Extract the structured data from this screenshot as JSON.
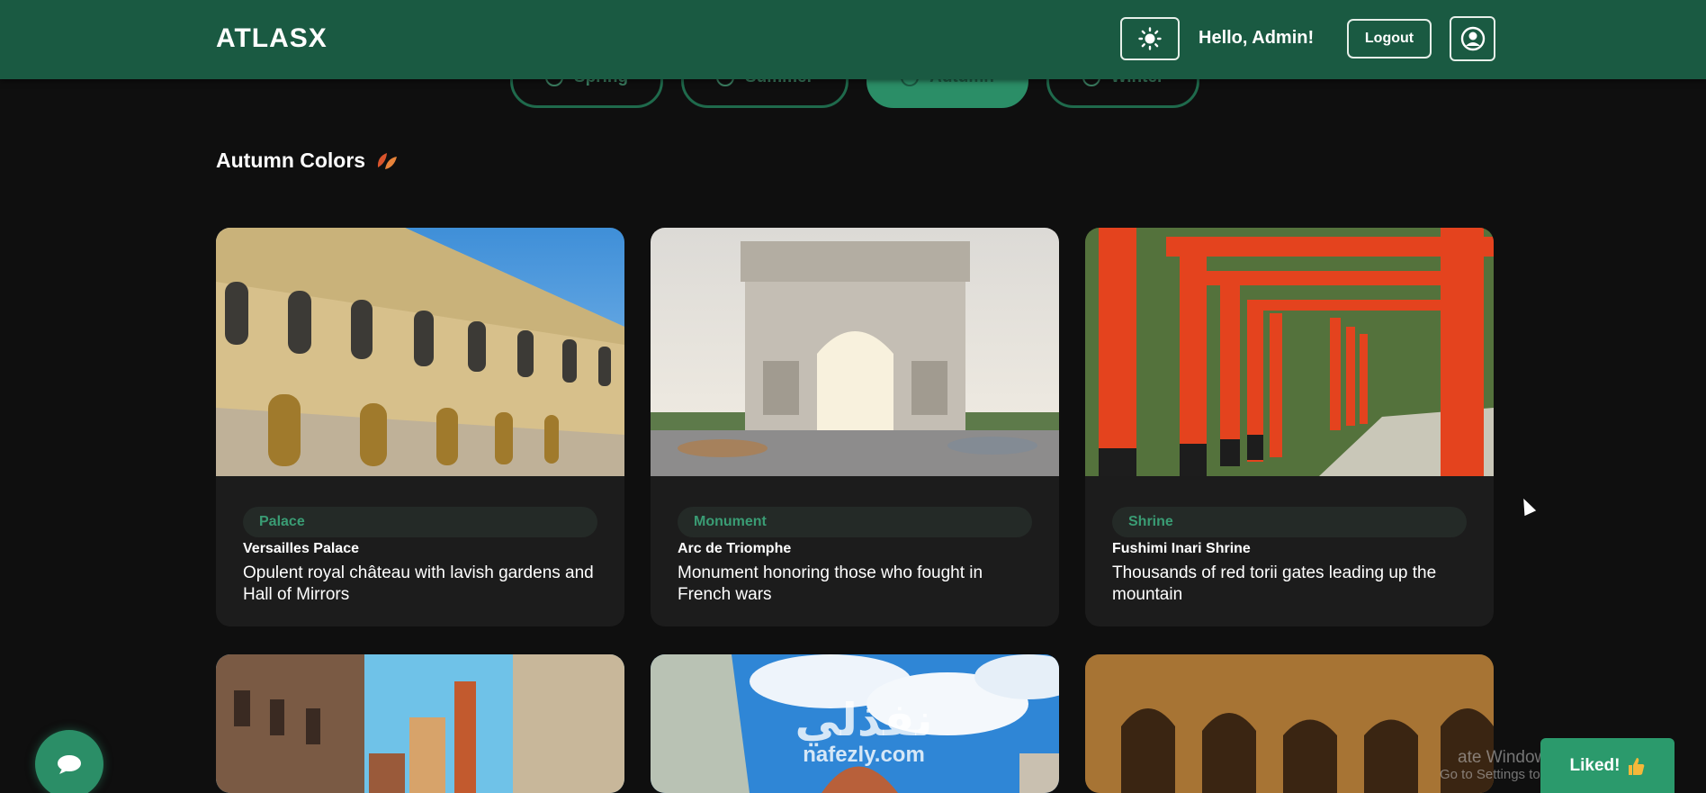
{
  "header": {
    "brand": "ATLASX",
    "greeting": "Hello, Admin!",
    "logout_label": "Logout",
    "theme_icon": "sun-icon",
    "avatar_icon": "user-circle-icon"
  },
  "seasons": [
    {
      "label": "Spring",
      "icon": "flower-icon",
      "active": false
    },
    {
      "label": "Summer",
      "icon": "sun-icon",
      "active": false
    },
    {
      "label": "Autumn",
      "icon": "leaf-icon",
      "active": true
    },
    {
      "label": "Winter",
      "icon": "snowflake-icon",
      "active": false
    }
  ],
  "section": {
    "title": "Autumn Colors",
    "icon": "autumn-leaves-icon"
  },
  "cards": [
    {
      "tag": "Palace",
      "name": "Versailles Palace",
      "description": "Opulent royal château with lavish gardens and Hall of Mirrors"
    },
    {
      "tag": "Monument",
      "name": "Arc de Triomphe",
      "description": "Monument honoring those who fought in French wars"
    },
    {
      "tag": "Shrine",
      "name": "Fushimi Inari Shrine",
      "description": "Thousands of red torii gates leading up the mountain"
    },
    {
      "tag": "",
      "name": "",
      "description": ""
    },
    {
      "tag": "",
      "name": "",
      "description": ""
    },
    {
      "tag": "",
      "name": "",
      "description": ""
    }
  ],
  "floating": {
    "chat_icon": "chat-bubble-icon",
    "liked_label": "Liked!",
    "liked_icon": "thumbs-up-icon"
  },
  "overlay": {
    "watermark_arabic": "نفذلي",
    "watermark_latin": "nafezly.com",
    "activate_line1": "ate Windows",
    "activate_line2": "Go to Settings to activate Windows."
  },
  "colors": {
    "header_bg": "#1a5a42",
    "accent": "#2b8e67",
    "page_bg": "#0f0f0f",
    "card_bg": "#1c1c1c",
    "tag_text": "#3a9c74"
  }
}
